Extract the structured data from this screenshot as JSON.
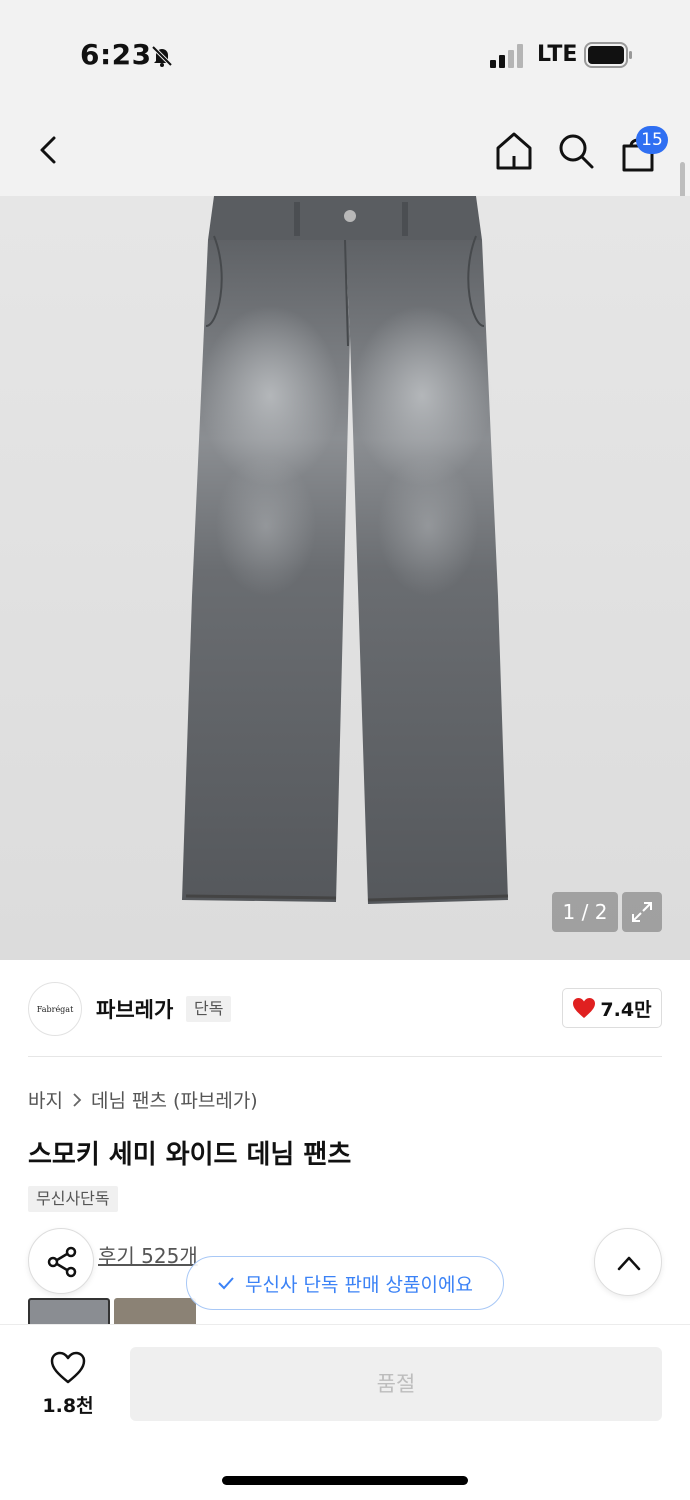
{
  "status_bar": {
    "time": "6:23",
    "network": "LTE"
  },
  "nav": {
    "cart_count": "15"
  },
  "gallery": {
    "counter": "1 / 2"
  },
  "brand": {
    "logo_text": "Fabrégat",
    "name": "파브레가",
    "tag": "단독",
    "likes": "7.4만",
    "heart_color": "#e02020"
  },
  "breadcrumb": {
    "items": [
      "바지",
      "데님 팬츠 (파브레가)"
    ]
  },
  "product": {
    "title": "스모키 세미 와이드 데님 팬츠",
    "tag": "무신사단독",
    "reviews": "후기 525개"
  },
  "toast": {
    "message": "무신사 단독 판매 상품이에요",
    "color": "#3b82f6"
  },
  "bottom_bar": {
    "wish_count": "1.8천",
    "action_label": "품절"
  },
  "accent": {
    "badge": "#2f6ff2"
  }
}
